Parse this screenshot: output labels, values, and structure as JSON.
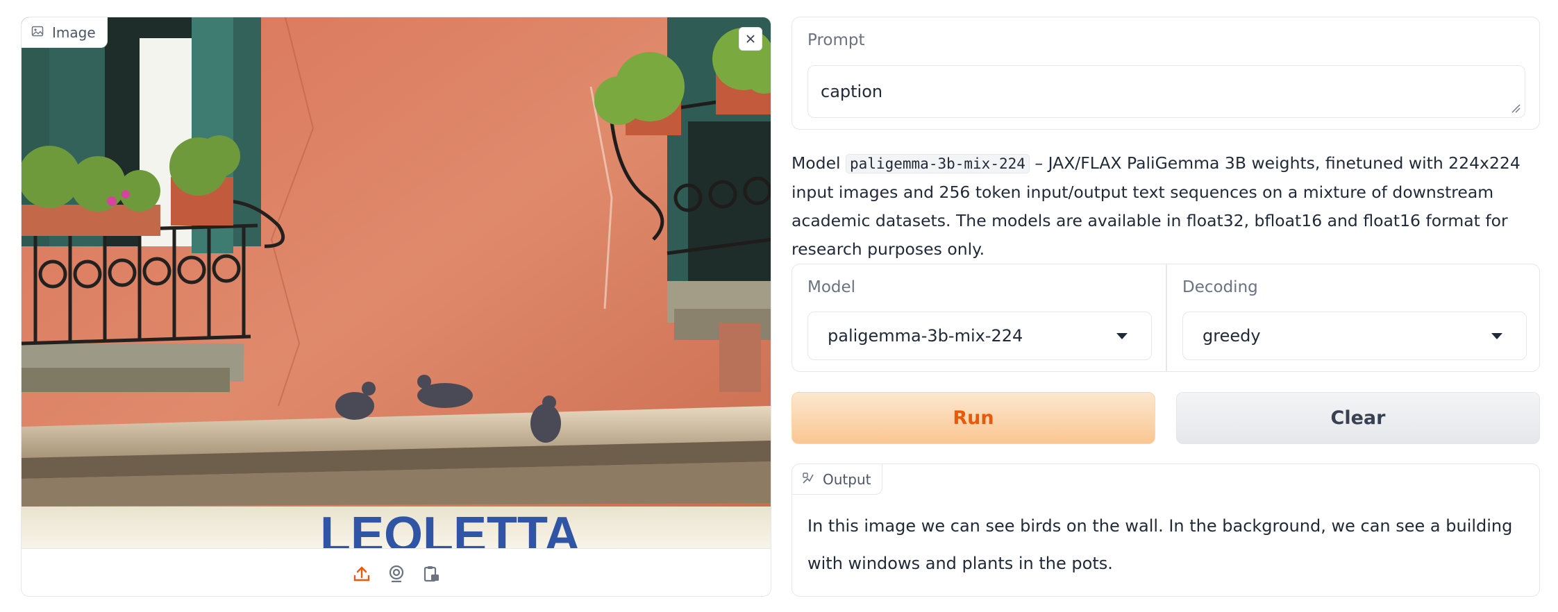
{
  "image_block": {
    "label": "Image",
    "photo_description_icon": "image-icon",
    "storefront_text": "LEOLETTA"
  },
  "prompt": {
    "label": "Prompt",
    "value": "caption"
  },
  "description": {
    "prefix": "Model ",
    "model_code": "paligemma-3b-mix-224",
    "suffix": " – JAX/FLAX PaliGemma 3B weights, finetuned with 224x224 input images and 256 token input/output text sequences on a mixture of downstream academic datasets. The models are available in float32, bfloat16 and float16 format for research purposes only."
  },
  "model_select": {
    "label": "Model",
    "value": "paligemma-3b-mix-224"
  },
  "decoding_select": {
    "label": "Decoding",
    "value": "greedy"
  },
  "buttons": {
    "run": "Run",
    "clear": "Clear"
  },
  "output": {
    "label": "Output",
    "text": " In this image we can see birds on the wall. In the background, we can see a building with windows and plants in the pots."
  },
  "colors": {
    "accent": "#ea580c",
    "border": "#e5e7eb"
  }
}
